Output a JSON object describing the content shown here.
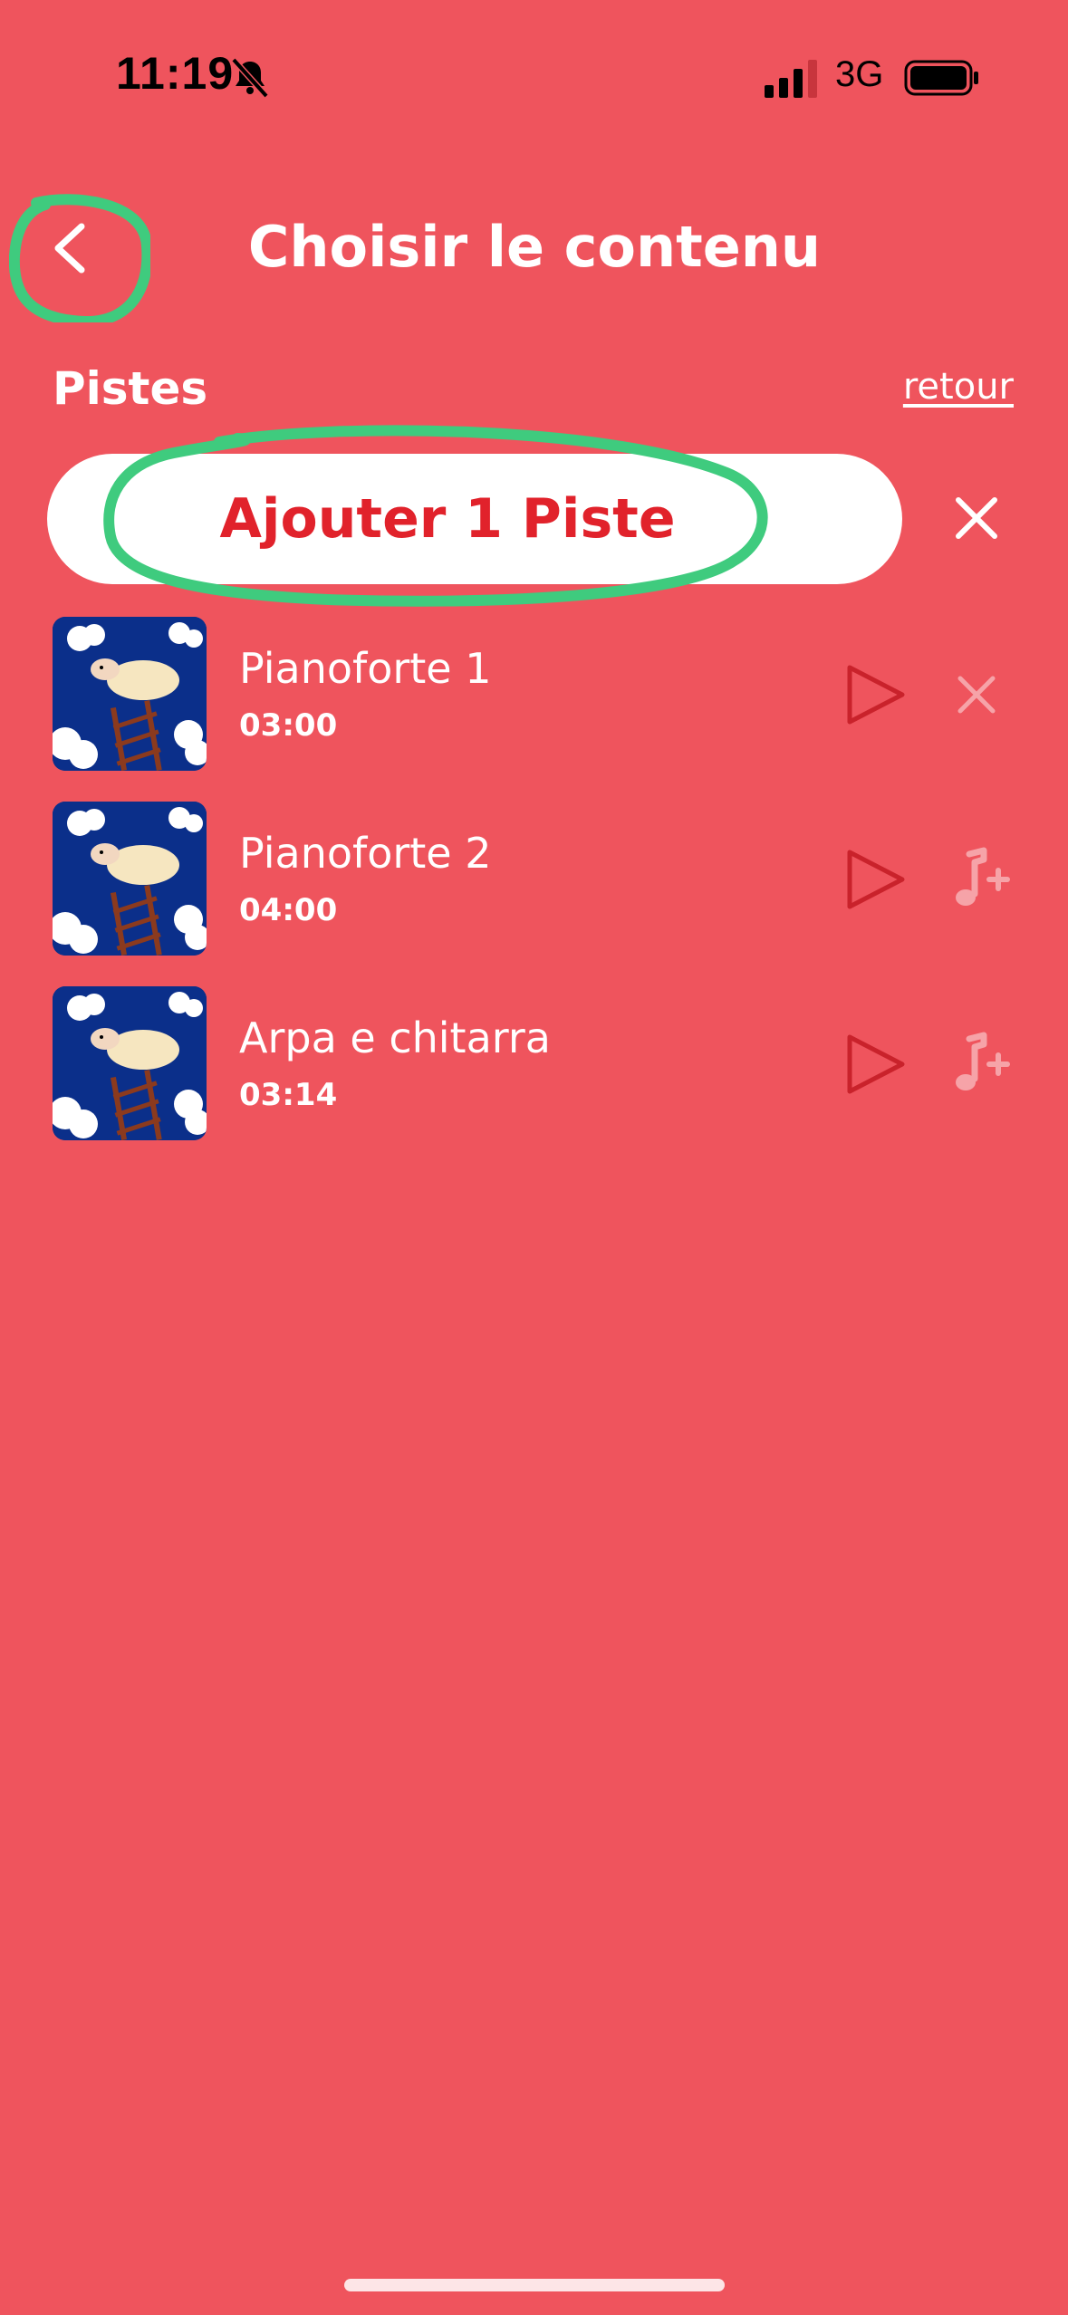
{
  "status_bar": {
    "time": "11:19",
    "network": "3G"
  },
  "header": {
    "title": "Choisir le contenu"
  },
  "section": {
    "label": "Pistes",
    "back_link": "retour"
  },
  "add_button": {
    "label": "Ajouter 1 Piste"
  },
  "tracks": [
    {
      "title": "Pianoforte 1",
      "duration": "03:00",
      "action_icon": "remove-icon"
    },
    {
      "title": "Pianoforte 2",
      "duration": "04:00",
      "action_icon": "add-music-icon"
    },
    {
      "title": "Arpa e chitarra",
      "duration": "03:14",
      "action_icon": "add-music-icon"
    }
  ],
  "colors": {
    "background": "#EF545D",
    "accent_red": "#E1222B",
    "highlight_green": "#3FCB7E"
  }
}
